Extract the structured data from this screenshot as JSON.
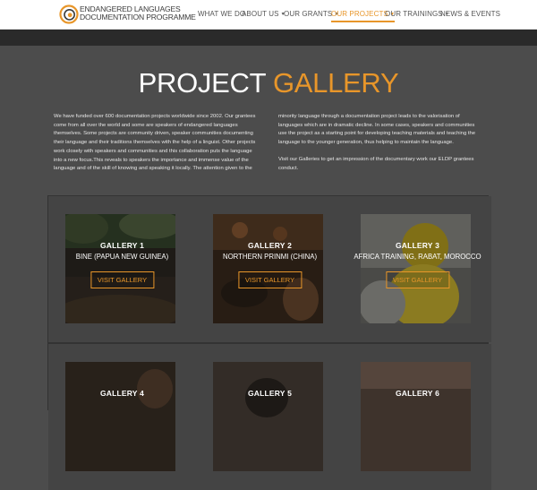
{
  "header": {
    "logo_line1": "ENDANGERED LANGUAGES",
    "logo_line2": "DOCUMENTATION PROGRAMME",
    "menu": [
      {
        "label": "WHAT WE DO",
        "caret": false,
        "active": false
      },
      {
        "label": "ABOUT US",
        "caret": true,
        "active": false
      },
      {
        "label": "OUR GRANTS",
        "caret": true,
        "active": false
      },
      {
        "label": "OUR PROJECTS",
        "caret": true,
        "active": true
      },
      {
        "label": "OUR TRAININGS",
        "caret": true,
        "active": false
      },
      {
        "label": "NEWS & EVENTS",
        "caret": false,
        "active": false
      }
    ]
  },
  "page": {
    "title_part1": "PROJECT ",
    "title_part2": "GALLERY",
    "intro_left": "We have funded over 600 documentation projects worldwide since 2002. Our grantees come from all over the world and some are speakers of endangered languages themselves. Some projects are community driven, speaker communities documenting their language and their traditions themselves with the help of a linguist. Other projects work closely with speakers and communities and this collaboration puts the language into a new focus.This reveals to speakers the importance and immense value of the language and of the skill of knowing and speaking it locally. The attention given to the",
    "intro_right_p1": "minority language through a documentation project leads to the valorisation of languages which are in dramatic decline. In some cases, speakers and communities use the project as a starting point for developing teaching materials and teaching the language to the younger generation, thus helping to maintain the language.",
    "intro_right_p2": "Visit our Galleries to get an impression of the documentary work our ELDP grantees conduct."
  },
  "galleries": [
    {
      "number": "GALLERY 1",
      "place": "BINE (PAPUA NEW GUINEA)",
      "button": "VISIT GALLERY"
    },
    {
      "number": "GALLERY 2",
      "place": "NORTHERN PRINMI (CHINA)",
      "button": "VISIT GALLERY"
    },
    {
      "number": "GALLERY 3",
      "place": "AFRICA TRAINING, RABAT, MOROCCO",
      "button": "VISIT GALLERY"
    },
    {
      "number": "GALLERY 4",
      "place": "",
      "button": ""
    },
    {
      "number": "GALLERY 5",
      "place": "",
      "button": ""
    },
    {
      "number": "GALLERY 6",
      "place": "",
      "button": ""
    }
  ],
  "colors": {
    "accent": "#e8962a",
    "background": "#4c4c4c",
    "grid": "#333333"
  }
}
